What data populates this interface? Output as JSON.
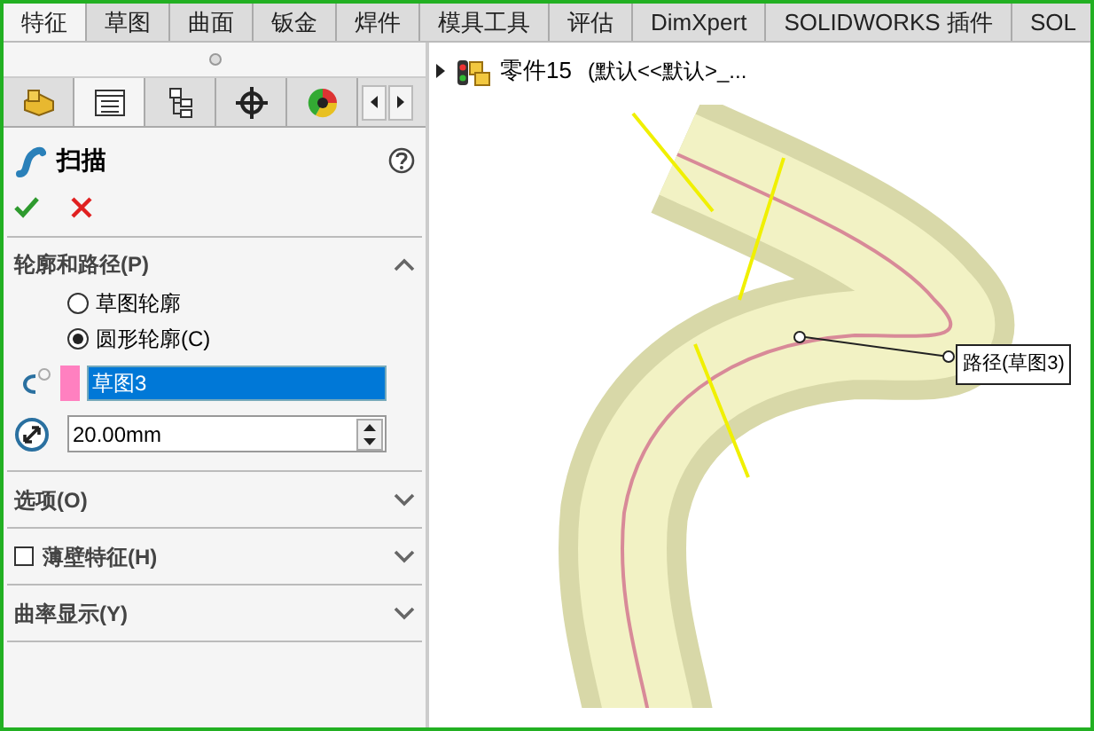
{
  "ribbon_tabs": [
    {
      "label": "特征",
      "selected": true
    },
    {
      "label": "草图",
      "selected": false
    },
    {
      "label": "曲面",
      "selected": false
    },
    {
      "label": "钣金",
      "selected": false
    },
    {
      "label": "焊件",
      "selected": false
    },
    {
      "label": "模具工具",
      "selected": false
    },
    {
      "label": "评估",
      "selected": false
    },
    {
      "label": "DimXpert",
      "selected": false
    },
    {
      "label": "SOLIDWORKS 插件",
      "selected": false
    },
    {
      "label": "SOL",
      "selected": false
    }
  ],
  "panel_tabs": [
    {
      "kind": "features",
      "selected": false
    },
    {
      "kind": "properties",
      "selected": true
    },
    {
      "kind": "config",
      "selected": false
    },
    {
      "kind": "target",
      "selected": false
    },
    {
      "kind": "display",
      "selected": false
    }
  ],
  "feature": {
    "title": "扫描"
  },
  "sections": [
    {
      "title": "轮廓和路径(P)",
      "expanded": true
    },
    {
      "title": "选项(O)",
      "expanded": false
    },
    {
      "title": "薄壁特征(H)",
      "expanded": false,
      "checked": false
    },
    {
      "title": "曲率显示(Y)",
      "expanded": false
    }
  ],
  "profile_options": [
    {
      "label": "草图轮廓",
      "selected": false
    },
    {
      "label": "圆形轮廓(C)",
      "selected": true
    }
  ],
  "path_field": {
    "value": "草图3"
  },
  "diameter_field": {
    "value": "20.00mm"
  },
  "tree": {
    "name": "零件15",
    "config": "(默认<<默认>_...",
    "expanded": false
  },
  "callout": "路径(草图3)"
}
